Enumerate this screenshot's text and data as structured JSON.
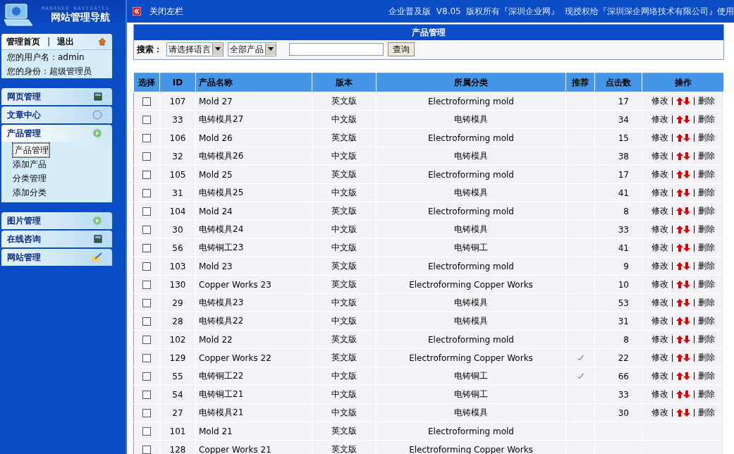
{
  "sidebar": {
    "logo": {
      "subtitle": "MANAGER NAVIGATES",
      "title": "网站管理导航"
    },
    "user_panel": {
      "home_link": "管理首页",
      "separator": "|",
      "logout_link": "退出",
      "username_line": "您的用户名：admin",
      "role_line": "您的身份：超级管理员"
    },
    "groups": [
      [
        {
          "label": "网页管理",
          "expanded": false
        },
        {
          "label": "文章中心",
          "expanded": false
        },
        {
          "label": "产品管理",
          "expanded": true,
          "items": [
            {
              "label": "产品管理",
              "selected": true
            },
            {
              "label": "添加产品",
              "selected": false
            },
            {
              "label": "分类管理",
              "selected": false
            },
            {
              "label": "添加分类",
              "selected": false
            }
          ]
        }
      ],
      [
        {
          "label": "图片管理",
          "expanded": false
        },
        {
          "label": "在线咨询",
          "expanded": false
        },
        {
          "label": "网站管理",
          "expanded": false
        }
      ]
    ]
  },
  "top_bar": {
    "close_sidebar": "关闭左栏",
    "copyright": "企业普及版  V8.05  版权所有『深圳企业网』  现授权给『深圳深企网络技术有限公司』使用"
  },
  "search_panel": {
    "title": "产品管理",
    "label": "搜索：",
    "language_select": "请选择语言",
    "category_select": "全部产品",
    "query_button": "查询"
  },
  "table": {
    "columns": [
      "选择",
      "ID",
      "产品名称",
      "版本",
      "所属分类",
      "推荐",
      "点击数",
      "操作"
    ],
    "rows": [
      {
        "checked": false,
        "id": "107",
        "name": "Mold 27",
        "version": "英文版",
        "category": "Electroforming mold",
        "recommended": false,
        "clicks": "17",
        "edit": "修改",
        "delete": "删除"
      },
      {
        "checked": false,
        "id": "33",
        "name": "电铸模具27",
        "version": "中文版",
        "category": "电铸模具",
        "recommended": false,
        "clicks": "34",
        "edit": "修改",
        "delete": "删除"
      },
      {
        "checked": false,
        "id": "106",
        "name": "Mold 26",
        "version": "英文版",
        "category": "Electroforming mold",
        "recommended": false,
        "clicks": "15",
        "edit": "修改",
        "delete": "删除"
      },
      {
        "checked": false,
        "id": "32",
        "name": "电铸模具26",
        "version": "中文版",
        "category": "电铸模具",
        "recommended": false,
        "clicks": "38",
        "edit": "修改",
        "delete": "删除"
      },
      {
        "checked": false,
        "id": "105",
        "name": "Mold 25",
        "version": "英文版",
        "category": "Electroforming mold",
        "recommended": false,
        "clicks": "17",
        "edit": "修改",
        "delete": "删除"
      },
      {
        "checked": false,
        "id": "31",
        "name": "电铸模具25",
        "version": "中文版",
        "category": "电铸模具",
        "recommended": false,
        "clicks": "41",
        "edit": "修改",
        "delete": "删除"
      },
      {
        "checked": false,
        "id": "104",
        "name": "Mold 24",
        "version": "英文版",
        "category": "Electroforming mold",
        "recommended": false,
        "clicks": "8",
        "edit": "修改",
        "delete": "删除"
      },
      {
        "checked": false,
        "id": "30",
        "name": "电铸模具24",
        "version": "中文版",
        "category": "电铸模具",
        "recommended": false,
        "clicks": "33",
        "edit": "修改",
        "delete": "删除"
      },
      {
        "checked": false,
        "id": "56",
        "name": "电铸铜工23",
        "version": "中文版",
        "category": "电铸铜工",
        "recommended": false,
        "clicks": "41",
        "edit": "修改",
        "delete": "删除"
      },
      {
        "checked": false,
        "id": "103",
        "name": "Mold 23",
        "version": "英文版",
        "category": "Electroforming mold",
        "recommended": false,
        "clicks": "9",
        "edit": "修改",
        "delete": "删除"
      },
      {
        "checked": false,
        "id": "130",
        "name": "Copper Works 23",
        "version": "英文版",
        "category": "Electroforming Copper Works",
        "recommended": false,
        "clicks": "10",
        "edit": "修改",
        "delete": "删除"
      },
      {
        "checked": false,
        "id": "29",
        "name": "电铸模具23",
        "version": "中文版",
        "category": "电铸模具",
        "recommended": false,
        "clicks": "53",
        "edit": "修改",
        "delete": "删除"
      },
      {
        "checked": false,
        "id": "28",
        "name": "电铸模具22",
        "version": "中文版",
        "category": "电铸模具",
        "recommended": false,
        "clicks": "31",
        "edit": "修改",
        "delete": "删除"
      },
      {
        "checked": false,
        "id": "102",
        "name": "Mold 22",
        "version": "英文版",
        "category": "Electroforming mold",
        "recommended": false,
        "clicks": "8",
        "edit": "修改",
        "delete": "删除"
      },
      {
        "checked": false,
        "id": "129",
        "name": "Copper Works 22",
        "version": "英文版",
        "category": "Electroforming Copper Works",
        "recommended": true,
        "clicks": "22",
        "edit": "修改",
        "delete": "删除"
      },
      {
        "checked": false,
        "id": "55",
        "name": "电铸铜工22",
        "version": "中文版",
        "category": "电铸铜工",
        "recommended": true,
        "clicks": "66",
        "edit": "修改",
        "delete": "删除"
      },
      {
        "checked": false,
        "id": "54",
        "name": "电铸铜工21",
        "version": "中文版",
        "category": "电铸铜工",
        "recommended": false,
        "clicks": "33",
        "edit": "修改",
        "delete": "删除"
      },
      {
        "checked": false,
        "id": "27",
        "name": "电铸模具21",
        "version": "中文版",
        "category": "电铸模具",
        "recommended": false,
        "clicks": "30",
        "edit": "修改",
        "delete": "删除"
      },
      {
        "checked": false,
        "id": "101",
        "name": "Mold 21",
        "version": "英文版",
        "category": "Electroforming mold",
        "recommended": false
      },
      {
        "checked": false,
        "id": "128",
        "name": "Copper Works 21",
        "version": "英文版",
        "category": "Electroforming Copper Works",
        "recommended": false
      }
    ]
  }
}
